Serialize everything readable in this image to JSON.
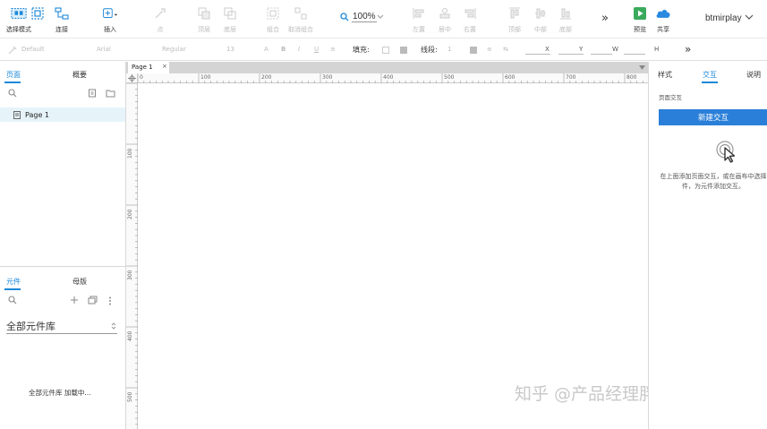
{
  "toolbar": {
    "select_mode": "选择模式",
    "connect": "连接",
    "insert": "插入",
    "point": "点",
    "top": "顶层",
    "bottom": "底层",
    "group": "组合",
    "ungroup": "取消组合",
    "zoom": "100%",
    "left_align": "左置",
    "center_align": "居中",
    "right_align": "右置",
    "top_align": "顶部",
    "middle_align": "中部",
    "bottom_align": "底部",
    "more": "»",
    "preview": "预览",
    "share": "共享",
    "user": "btmirplay"
  },
  "format_bar": {
    "style": "Default",
    "font": "Arial",
    "weight": "Regular",
    "size": "13",
    "fill_label": "填充:",
    "stroke_label": "线段:",
    "stroke_value": "1",
    "x_label": "X",
    "y_label": "Y",
    "w_label": "W",
    "h_label": "H",
    "more": "»"
  },
  "left_panel": {
    "tabs": [
      "页面",
      "概要"
    ],
    "active_tab": "页面",
    "pages": [
      {
        "name": "Page 1"
      }
    ],
    "bottom_tabs": [
      "元件",
      "母版"
    ],
    "library_name": "全部元件库",
    "loading_text": "全部元件库 加载中..."
  },
  "canvas": {
    "tab_name": "Page 1",
    "tab_close": "×",
    "ruler_h": [
      "0",
      "100",
      "200",
      "300",
      "400",
      "500",
      "600",
      "700",
      "800"
    ],
    "ruler_v": [
      "100",
      "200",
      "300",
      "400",
      "500"
    ],
    "watermark": "知乎 @产品经理胖大欣"
  },
  "right_panel": {
    "tabs": [
      "样式",
      "交互",
      "说明"
    ],
    "active_tab": "交互",
    "section_label": "页面交互",
    "new_interaction_button": "新建交互",
    "hint_line1": "在上面添加页面交互，或在画布中选择",
    "hint_line2": "件，为元件添加交互。"
  },
  "colors": {
    "accent": "#1e88d8",
    "button": "#2a7fd8",
    "page_selected": "#e6f4fa",
    "preview_icon": "#3aaa5c",
    "share_icon": "#2a8ae0"
  }
}
